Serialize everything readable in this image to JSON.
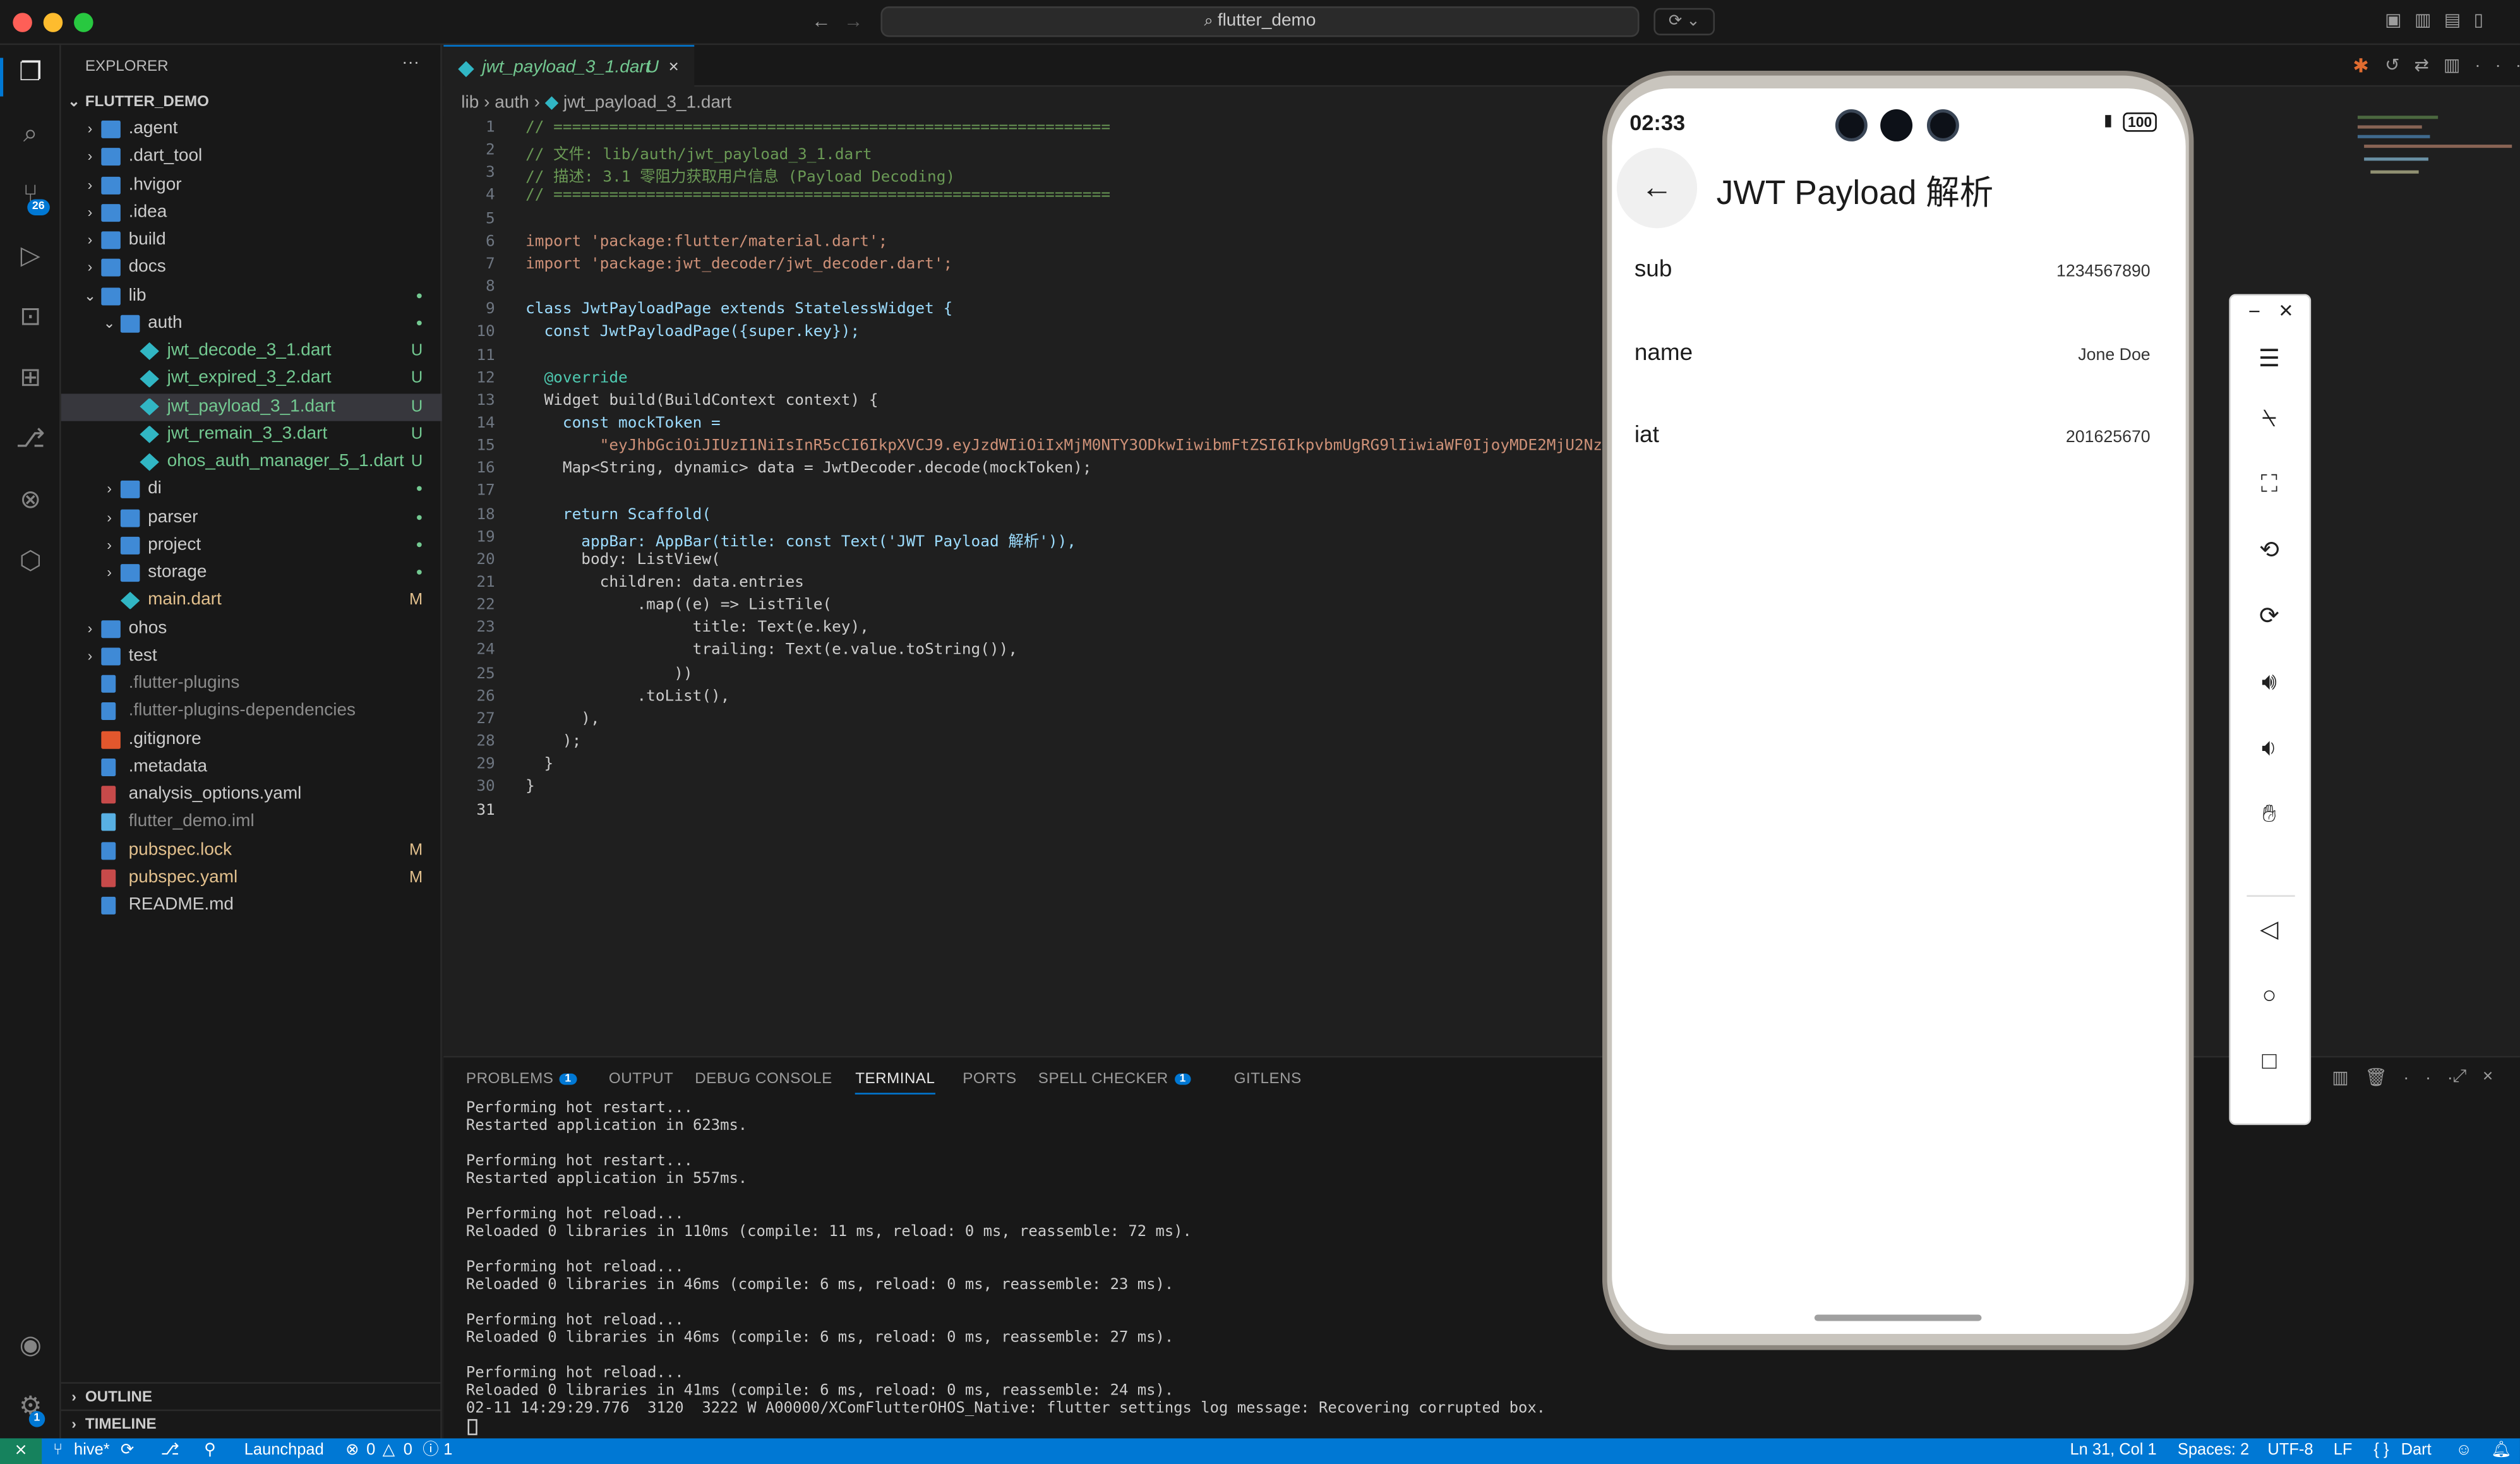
{
  "titlebar": {
    "search": "flutter_demo"
  },
  "activity": {
    "scm_badge": "26",
    "settings_badge": "1"
  },
  "sidebar": {
    "header": "EXPLORER",
    "root": "FLUTTER_DEMO",
    "items": [
      {
        "label": ".agent",
        "kind": "folder",
        "depth": 0,
        "chev": "›",
        "status": ""
      },
      {
        "label": ".dart_tool",
        "kind": "folder",
        "depth": 0,
        "chev": "›",
        "status": ""
      },
      {
        "label": ".hvigor",
        "kind": "folder",
        "depth": 0,
        "chev": "›",
        "status": ""
      },
      {
        "label": ".idea",
        "kind": "folder",
        "depth": 0,
        "chev": "›",
        "status": ""
      },
      {
        "label": "build",
        "kind": "folder",
        "depth": 0,
        "chev": "›",
        "status": ""
      },
      {
        "label": "docs",
        "kind": "folder",
        "depth": 0,
        "chev": "›",
        "status": ""
      },
      {
        "label": "lib",
        "kind": "folder",
        "depth": 0,
        "chev": "⌄",
        "status": "●"
      },
      {
        "label": "auth",
        "kind": "folder",
        "depth": 1,
        "chev": "⌄",
        "status": "●"
      },
      {
        "label": "jwt_decode_3_1.dart",
        "kind": "dart",
        "depth": 2,
        "chev": "",
        "status": "U"
      },
      {
        "label": "jwt_expired_3_2.dart",
        "kind": "dart",
        "depth": 2,
        "chev": "",
        "status": "U"
      },
      {
        "label": "jwt_payload_3_1.dart",
        "kind": "dart",
        "depth": 2,
        "chev": "",
        "status": "U",
        "selected": true
      },
      {
        "label": "jwt_remain_3_3.dart",
        "kind": "dart",
        "depth": 2,
        "chev": "",
        "status": "U"
      },
      {
        "label": "ohos_auth_manager_5_1.dart",
        "kind": "dart",
        "depth": 2,
        "chev": "",
        "status": "U"
      },
      {
        "label": "di",
        "kind": "folder",
        "depth": 1,
        "chev": "›",
        "status": "●"
      },
      {
        "label": "parser",
        "kind": "folder",
        "depth": 1,
        "chev": "›",
        "status": "●"
      },
      {
        "label": "project",
        "kind": "folder",
        "depth": 1,
        "chev": "›",
        "status": "●"
      },
      {
        "label": "storage",
        "kind": "folder",
        "depth": 1,
        "chev": "›",
        "status": "●"
      },
      {
        "label": "main.dart",
        "kind": "dart",
        "depth": 1,
        "chev": "",
        "status": "M",
        "modified": true
      },
      {
        "label": "ohos",
        "kind": "folder",
        "depth": 0,
        "chev": "›",
        "status": ""
      },
      {
        "label": "test",
        "kind": "folder",
        "depth": 0,
        "chev": "›",
        "status": ""
      },
      {
        "label": ".flutter-plugins",
        "kind": "file",
        "depth": 0,
        "chev": "",
        "status": "",
        "dim": true
      },
      {
        "label": ".flutter-plugins-dependencies",
        "kind": "file",
        "depth": 0,
        "chev": "",
        "status": "",
        "dim": true
      },
      {
        "label": ".gitignore",
        "kind": "git",
        "depth": 0,
        "chev": "",
        "status": ""
      },
      {
        "label": ".metadata",
        "kind": "file",
        "depth": 0,
        "chev": "",
        "status": ""
      },
      {
        "label": "analysis_options.yaml",
        "kind": "yaml",
        "depth": 0,
        "chev": "",
        "status": ""
      },
      {
        "label": "flutter_demo.iml",
        "kind": "xml",
        "depth": 0,
        "chev": "",
        "status": "",
        "dim": true
      },
      {
        "label": "pubspec.lock",
        "kind": "file",
        "depth": 0,
        "chev": "",
        "status": "M",
        "modified": true
      },
      {
        "label": "pubspec.yaml",
        "kind": "yaml",
        "depth": 0,
        "chev": "",
        "status": "M",
        "modified": true
      },
      {
        "label": "README.md",
        "kind": "md",
        "depth": 0,
        "chev": "",
        "status": ""
      }
    ],
    "outline": "OUTLINE",
    "timeline": "TIMELINE"
  },
  "editor": {
    "tab_label": "jwt_payload_3_1.dart",
    "tab_status": "U",
    "breadcrumb": [
      "lib",
      "auth",
      "jwt_payload_3_1.dart"
    ],
    "lines": [
      "// ============================================================",
      "// 文件: lib/auth/jwt_payload_3_1.dart",
      "// 描述: 3.1 零阻力获取用户信息 (Payload Decoding)",
      "// ============================================================",
      "",
      "import 'package:flutter/material.dart';",
      "import 'package:jwt_decoder/jwt_decoder.dart';",
      "",
      "class JwtPayloadPage extends StatelessWidget {",
      "  const JwtPayloadPage({super.key});",
      "",
      "  @override",
      "  Widget build(BuildContext context) {",
      "    const mockToken =",
      "        \"eyJhbGciOiJIUzI1NiIsInR5cCI6IkpXVCJ9.eyJzdWIiOiIxMjM0NTY3ODkwIiwibmFtZSI6IkpvbmUgRG9lIiwiaWF0IjoyMDE2MjU2NzB9\";",
      "    Map<String, dynamic> data = JwtDecoder.decode(mockToken);",
      "",
      "    return Scaffold(",
      "      appBar: AppBar(title: const Text('JWT Payload 解析')),",
      "      body: ListView(",
      "        children: data.entries",
      "            .map((e) => ListTile(",
      "                  title: Text(e.key),",
      "                  trailing: Text(e.value.toString()),",
      "                ))",
      "            .toList(),",
      "      ),",
      "    );",
      "  }",
      "}",
      ""
    ]
  },
  "panel": {
    "tabs": [
      {
        "label": "PROBLEMS",
        "badge": "1"
      },
      {
        "label": "OUTPUT"
      },
      {
        "label": "DEBUG CONSOLE"
      },
      {
        "label": "TERMINAL",
        "active": true
      },
      {
        "label": "PORTS"
      },
      {
        "label": "SPELL CHECKER",
        "badge": "1"
      },
      {
        "label": "GITLENS"
      }
    ],
    "terminal": [
      "Performing hot restart...",
      "Restarted application in 623ms.",
      "",
      "Performing hot restart...",
      "Restarted application in 557ms.",
      "",
      "Performing hot reload...",
      "Reloaded 0 libraries in 110ms (compile: 11 ms, reload: 0 ms, reassemble: 72 ms).",
      "",
      "Performing hot reload...",
      "Reloaded 0 libraries in 46ms (compile: 6 ms, reload: 0 ms, reassemble: 23 ms).",
      "",
      "Performing hot reload...",
      "Reloaded 0 libraries in 46ms (compile: 6 ms, reload: 0 ms, reassemble: 27 ms).",
      "",
      "Performing hot reload...",
      "Reloaded 0 libraries in 41ms (compile: 6 ms, reload: 0 ms, reassemble: 24 ms).",
      "02-11 14:29:29.776  3120  3222 W A00000/XComFlutterOHOS_Native: flutter settings log message: Recovering corrupted box."
    ]
  },
  "status": {
    "branch": "hive*",
    "launchpad": "Launchpad",
    "errors": "0",
    "warnings": "0",
    "info": "1",
    "position": "Ln 31, Col 1",
    "spaces": "Spaces: 2",
    "encoding": "UTF-8",
    "eol": "LF",
    "language": "Dart"
  },
  "phone": {
    "time": "02:33",
    "battery": "100",
    "title": "JWT Payload 解析",
    "rows": [
      {
        "key": "sub",
        "value": "1234567890"
      },
      {
        "key": "name",
        "value": "Jone Doe"
      },
      {
        "key": "iat",
        "value": "201625670"
      }
    ]
  },
  "colors": {
    "accent": "#0078d4",
    "untracked": "#73c991",
    "modified": "#e2c08d",
    "dart": "#31b6c4",
    "folder": "#3f8ad6"
  }
}
